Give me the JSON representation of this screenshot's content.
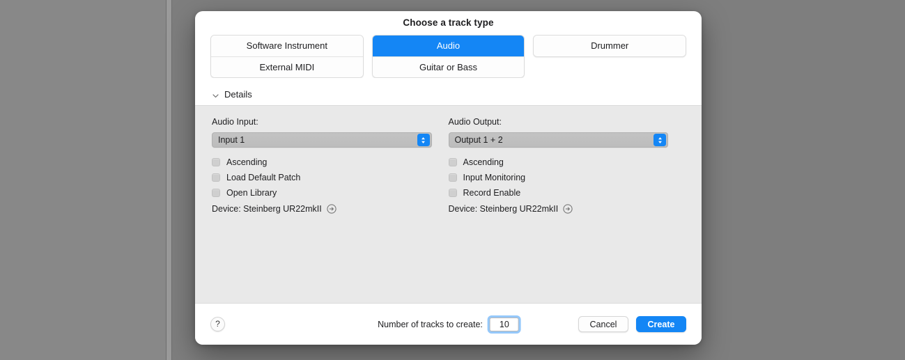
{
  "dialog": {
    "title": "Choose a track type",
    "track_types": {
      "column_1": [
        {
          "label": "Software Instrument",
          "selected": false
        },
        {
          "label": "External MIDI",
          "selected": false
        }
      ],
      "column_2": [
        {
          "label": "Audio",
          "selected": true
        },
        {
          "label": "Guitar or Bass",
          "selected": false
        }
      ],
      "column_3": [
        {
          "label": "Drummer",
          "selected": false
        }
      ]
    },
    "details": {
      "label": "Details",
      "expanded": true,
      "input_column": {
        "heading": "Audio Input:",
        "popup_value": "Input 1",
        "checkboxes": [
          {
            "label": "Ascending",
            "checked": false
          },
          {
            "label": "Load Default Patch",
            "checked": false
          },
          {
            "label": "Open Library",
            "checked": false
          }
        ],
        "device": "Device: Steinberg UR22mkII"
      },
      "output_column": {
        "heading": "Audio Output:",
        "popup_value": "Output 1 + 2",
        "checkboxes": [
          {
            "label": "Ascending",
            "checked": false
          },
          {
            "label": "Input Monitoring",
            "checked": false
          },
          {
            "label": "Record Enable",
            "checked": false
          }
        ],
        "device": "Device: Steinberg UR22mkII"
      }
    },
    "footer": {
      "help_label": "?",
      "tracks_label": "Number of tracks to create:",
      "tracks_value": "10",
      "cancel_label": "Cancel",
      "create_label": "Create"
    }
  },
  "colors": {
    "accent_blue": "#1486f5",
    "panel_gray": "#e9e9e9",
    "desktop_gray": "#808080"
  }
}
